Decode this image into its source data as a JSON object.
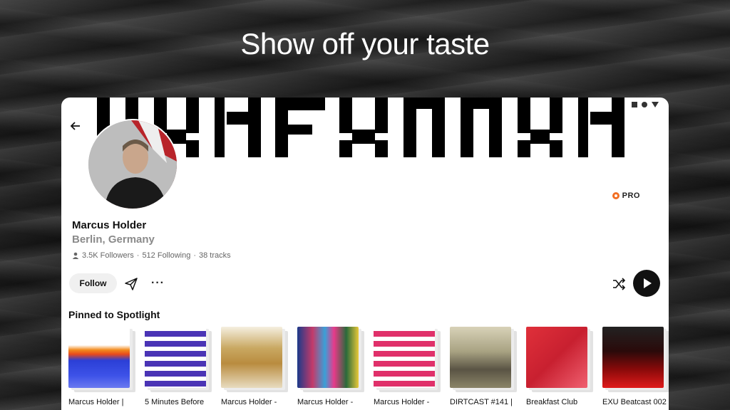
{
  "headline": "Show off your taste",
  "profile": {
    "name": "Marcus Holder",
    "location": "Berlin, Germany",
    "followers": "3.5K Followers",
    "following": "512 Following",
    "tracks": "38 tracks",
    "badge": "PRO",
    "follow_label": "Follow",
    "more_label": "···"
  },
  "section": {
    "title": "Pinned to Spotlight"
  },
  "tracks": [
    {
      "title": "Marcus Holder |"
    },
    {
      "title": "5 Minutes Before"
    },
    {
      "title": "Marcus Holder -"
    },
    {
      "title": "Marcus Holder -"
    },
    {
      "title": "Marcus Holder -"
    },
    {
      "title": "DIRTCAST #141 |"
    },
    {
      "title": "Breakfast Club"
    },
    {
      "title": "EXU Beatcast 002 -"
    }
  ],
  "colors": {
    "accent": "#f26f23",
    "text": "#111111",
    "muted": "#8a8a8a"
  }
}
